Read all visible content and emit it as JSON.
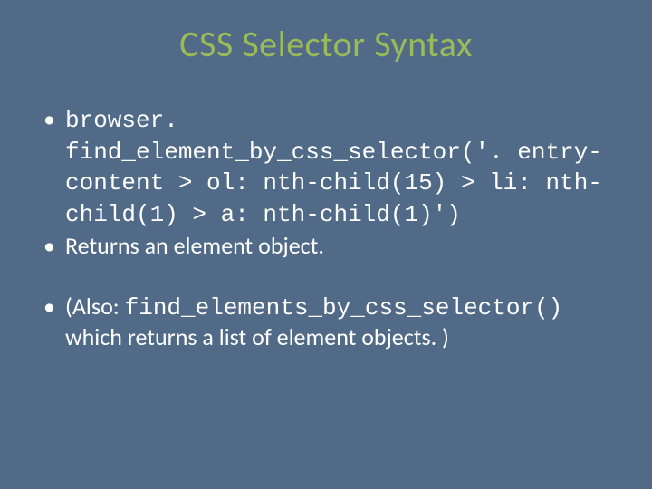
{
  "title": "CSS Selector Syntax",
  "bullets": {
    "b1": {
      "code": "browser. find_element_by_css_selector('. entry-content > ol: nth-child(15) > li: nth-child(1) > a: nth-child(1)')"
    },
    "b2": {
      "text": "Returns an element object."
    },
    "b3": {
      "pre": "(Also: ",
      "code": "find_elements_by_css_selector()",
      "post": " which returns a list of element objects. )"
    }
  }
}
